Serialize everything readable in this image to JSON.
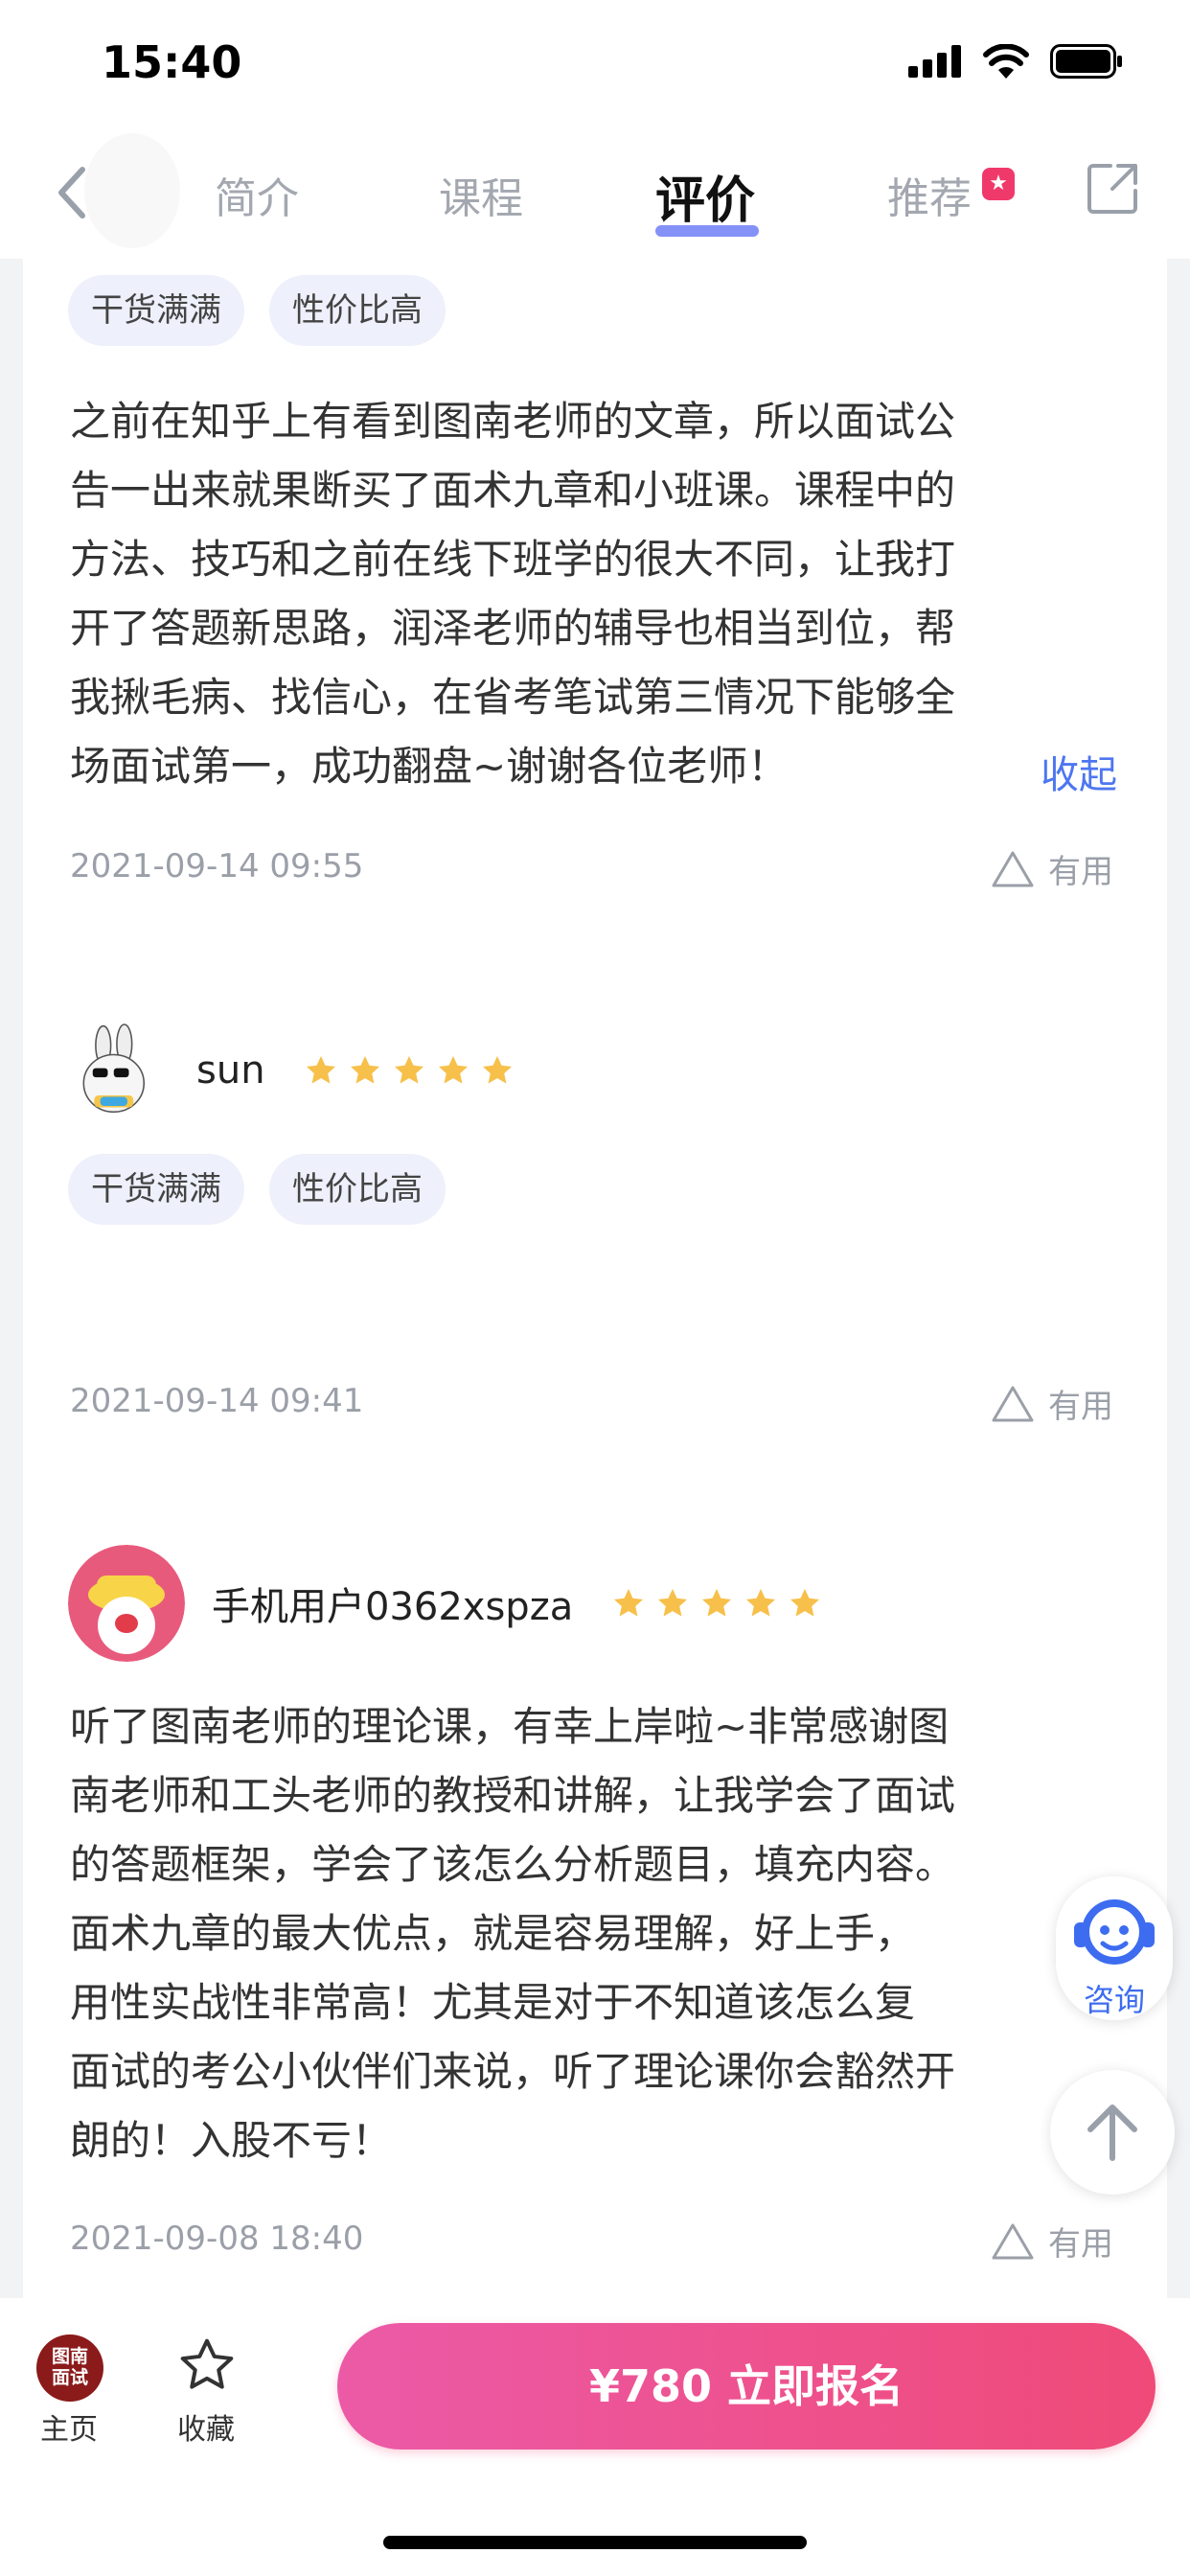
{
  "status_bar": {
    "time": "15:40"
  },
  "header": {
    "tabs": [
      {
        "label": "简介"
      },
      {
        "label": "课程"
      },
      {
        "label": "评价",
        "active": true
      },
      {
        "label": "推荐"
      }
    ]
  },
  "reviews": [
    {
      "tags": [
        "干货满满",
        "性价比高"
      ],
      "text_lines": [
        "之前在知乎上有看到图南老师的文章，所以面试公",
        "告一出来就果断买了面术九章和小班课。课程中的",
        "方法、技巧和之前在线下班学的很大不同，让我打",
        "开了答题新思路，润泽老师的辅导也相当到位，帮",
        "我揪毛病、找信心，在省考笔试第三情况下能够全",
        "场面试第一，成功翻盘~谢谢各位老师！"
      ],
      "collapse_label": "收起",
      "date": "2021-09-14 09:55",
      "useful_label": "有用"
    },
    {
      "username": "sun",
      "rating": 5,
      "tags": [
        "干货满满",
        "性价比高"
      ],
      "date": "2021-09-14 09:41",
      "useful_label": "有用"
    },
    {
      "username": "手机用户0362xspza",
      "rating": 5,
      "text_lines": [
        "听了图南老师的理论课，有幸上岸啦~非常感谢图",
        "南老师和工头老师的教授和讲解，让我学会了面试",
        "的答题框架，学会了该怎么分析题目，填充内容。",
        "面术九章的最大优点，就是容易理解，好上手，",
        "用性实战性非常高！尤其是对于不知道该怎么复",
        "面试的考公小伙伴们来说，听了理论课你会豁然开",
        "朗的！入股不亏！"
      ],
      "date": "2021-09-08 18:40",
      "useful_label": "有用"
    }
  ],
  "floating": {
    "consult_label": "咨询"
  },
  "bottom_bar": {
    "home_logo": "图南\n面试",
    "home_label": "主页",
    "fav_label": "收藏",
    "enroll_label": "¥780 立即报名"
  },
  "colors": {
    "accent": "#4d76f0",
    "enroll": "#ef4a78",
    "star": "#f7c04a"
  }
}
